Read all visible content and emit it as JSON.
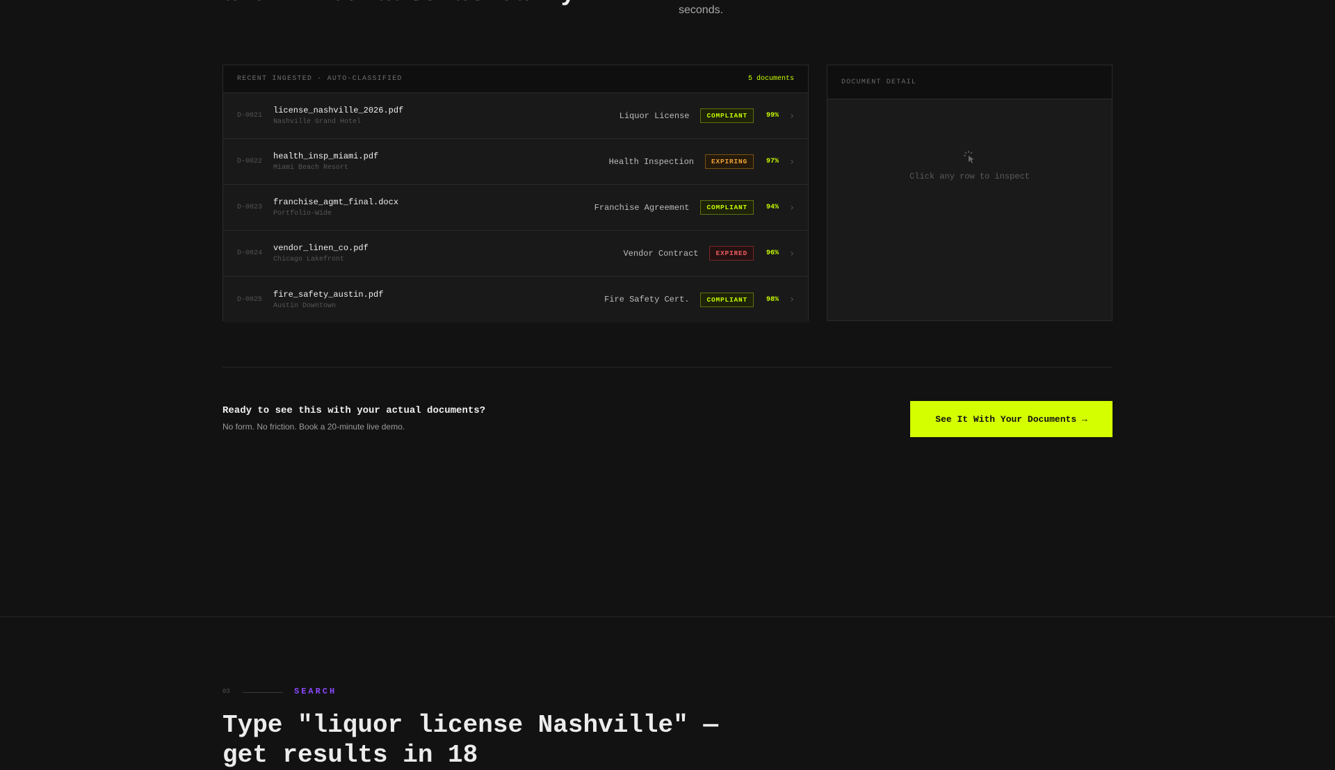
{
  "hero": {
    "heading_fragment": "and filed automatically.",
    "subtext_fragment": "seconds."
  },
  "documents_panel": {
    "title": "RECENT INGESTED · AUTO-CLASSIFIED",
    "count": "5 documents",
    "rows": [
      {
        "id": "D-0021",
        "file": "license_nashville_2026.pdf",
        "location": "Nashville Grand Hotel",
        "type": "Liquor License",
        "status": "COMPLIANT",
        "confidence": "99%"
      },
      {
        "id": "D-0022",
        "file": "health_insp_miami.pdf",
        "location": "Miami Beach Resort",
        "type": "Health Inspection",
        "status": "EXPIRING",
        "confidence": "97%"
      },
      {
        "id": "D-0023",
        "file": "franchise_agmt_final.docx",
        "location": "Portfolio-Wide",
        "type": "Franchise Agreement",
        "status": "COMPLIANT",
        "confidence": "94%"
      },
      {
        "id": "D-0024",
        "file": "vendor_linen_co.pdf",
        "location": "Chicago Lakefront",
        "type": "Vendor Contract",
        "status": "EXPIRED",
        "confidence": "96%"
      },
      {
        "id": "D-0025",
        "file": "fire_safety_austin.pdf",
        "location": "Austin Downtown",
        "type": "Fire Safety Cert.",
        "status": "COMPLIANT",
        "confidence": "98%"
      }
    ]
  },
  "detail_panel": {
    "title": "DOCUMENT DETAIL",
    "hint": "Click any row to inspect",
    "icon": "pointer-click-icon"
  },
  "cta": {
    "title": "Ready to see this with your actual documents?",
    "subtitle": "No form. No friction. Book a 20-minute live demo.",
    "button": "See It With Your Documents →"
  },
  "search_section": {
    "number": "03",
    "label": "SEARCH",
    "heading": "Type \"liquor license Nashville\" — get results in 18"
  },
  "colors": {
    "accent": "#d4ff00",
    "compliant": "#c8ff00",
    "expiring": "#f4a437",
    "expired": "#ef5e5e",
    "section_label": "#8b48ff"
  }
}
